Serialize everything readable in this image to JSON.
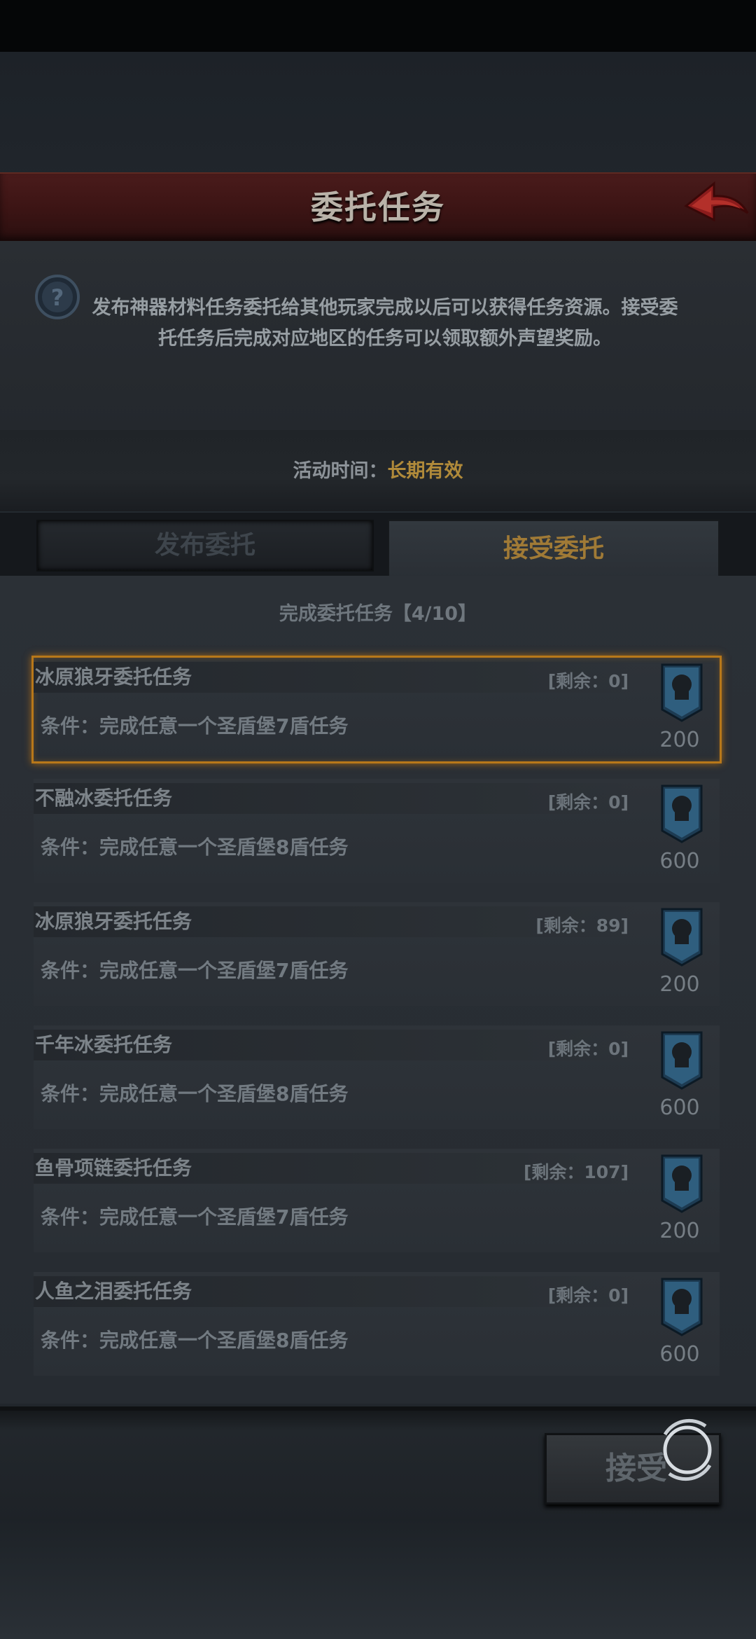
{
  "header": {
    "title": "委托任务",
    "back_icon": "back-arrow-icon"
  },
  "info": {
    "description": "发布神器材料任务委托给其他玩家完成以后可以获得任务资源。接受委托任务后完成对应地区的任务可以领取额外声望奖励。",
    "time_label": "活动时间：",
    "time_value": "长期有效"
  },
  "tabs": [
    {
      "label": "发布委托",
      "active": false
    },
    {
      "label": "接受委托",
      "active": true
    }
  ],
  "list_header": "完成委托任务【4/10】",
  "tasks": [
    {
      "name": "冰原狼牙委托任务",
      "remain": "[剩余：0]",
      "condition": "条件：完成任意一个圣盾堡7盾任务",
      "reward": "200",
      "selected": true
    },
    {
      "name": "不融冰委托任务",
      "remain": "[剩余：0]",
      "condition": "条件：完成任意一个圣盾堡8盾任务",
      "reward": "600",
      "selected": false
    },
    {
      "name": "冰原狼牙委托任务",
      "remain": "[剩余：89]",
      "condition": "条件：完成任意一个圣盾堡7盾任务",
      "reward": "200",
      "selected": false
    },
    {
      "name": "千年冰委托任务",
      "remain": "[剩余：0]",
      "condition": "条件：完成任意一个圣盾堡8盾任务",
      "reward": "600",
      "selected": false
    },
    {
      "name": "鱼骨项链委托任务",
      "remain": "[剩余：107]",
      "condition": "条件：完成任意一个圣盾堡7盾任务",
      "reward": "200",
      "selected": false
    },
    {
      "name": "人鱼之泪委托任务",
      "remain": "[剩余：0]",
      "condition": "条件：完成任意一个圣盾堡8盾任务",
      "reward": "600",
      "selected": false
    }
  ],
  "footer": {
    "accept_label": "接受"
  },
  "colors": {
    "accent_gold": "#b08a3a",
    "header_red": "#4a1b1b",
    "selected_border": "#b8781a"
  }
}
